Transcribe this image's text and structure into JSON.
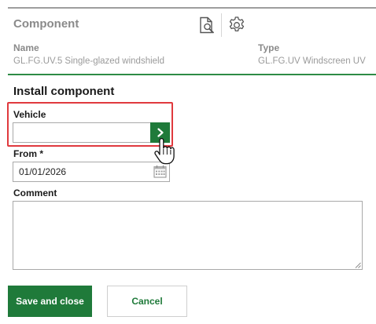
{
  "component": {
    "title": "Component",
    "name_label": "Name",
    "name_value": "GL.FG.UV.5 Single-glazed windshield",
    "type_label": "Type",
    "type_value": "GL.FG.UV Windscreen UV",
    "icons": [
      "document-search-icon",
      "gear-icon"
    ]
  },
  "form": {
    "title": "Install component",
    "vehicle": {
      "label": "Vehicle",
      "value": "",
      "button_icon": "chevron-right-icon"
    },
    "from": {
      "label": "From *",
      "value": "01/01/2026",
      "icon": "calendar-icon"
    },
    "comment": {
      "label": "Comment",
      "value": ""
    }
  },
  "actions": {
    "save_label": "Save and close",
    "cancel_label": "Cancel"
  },
  "colors": {
    "accent_green": "#1f7a3a",
    "divider_green": "#2e8b45",
    "highlight_red": "#e0393e",
    "muted_text": "#8a8a8a"
  }
}
